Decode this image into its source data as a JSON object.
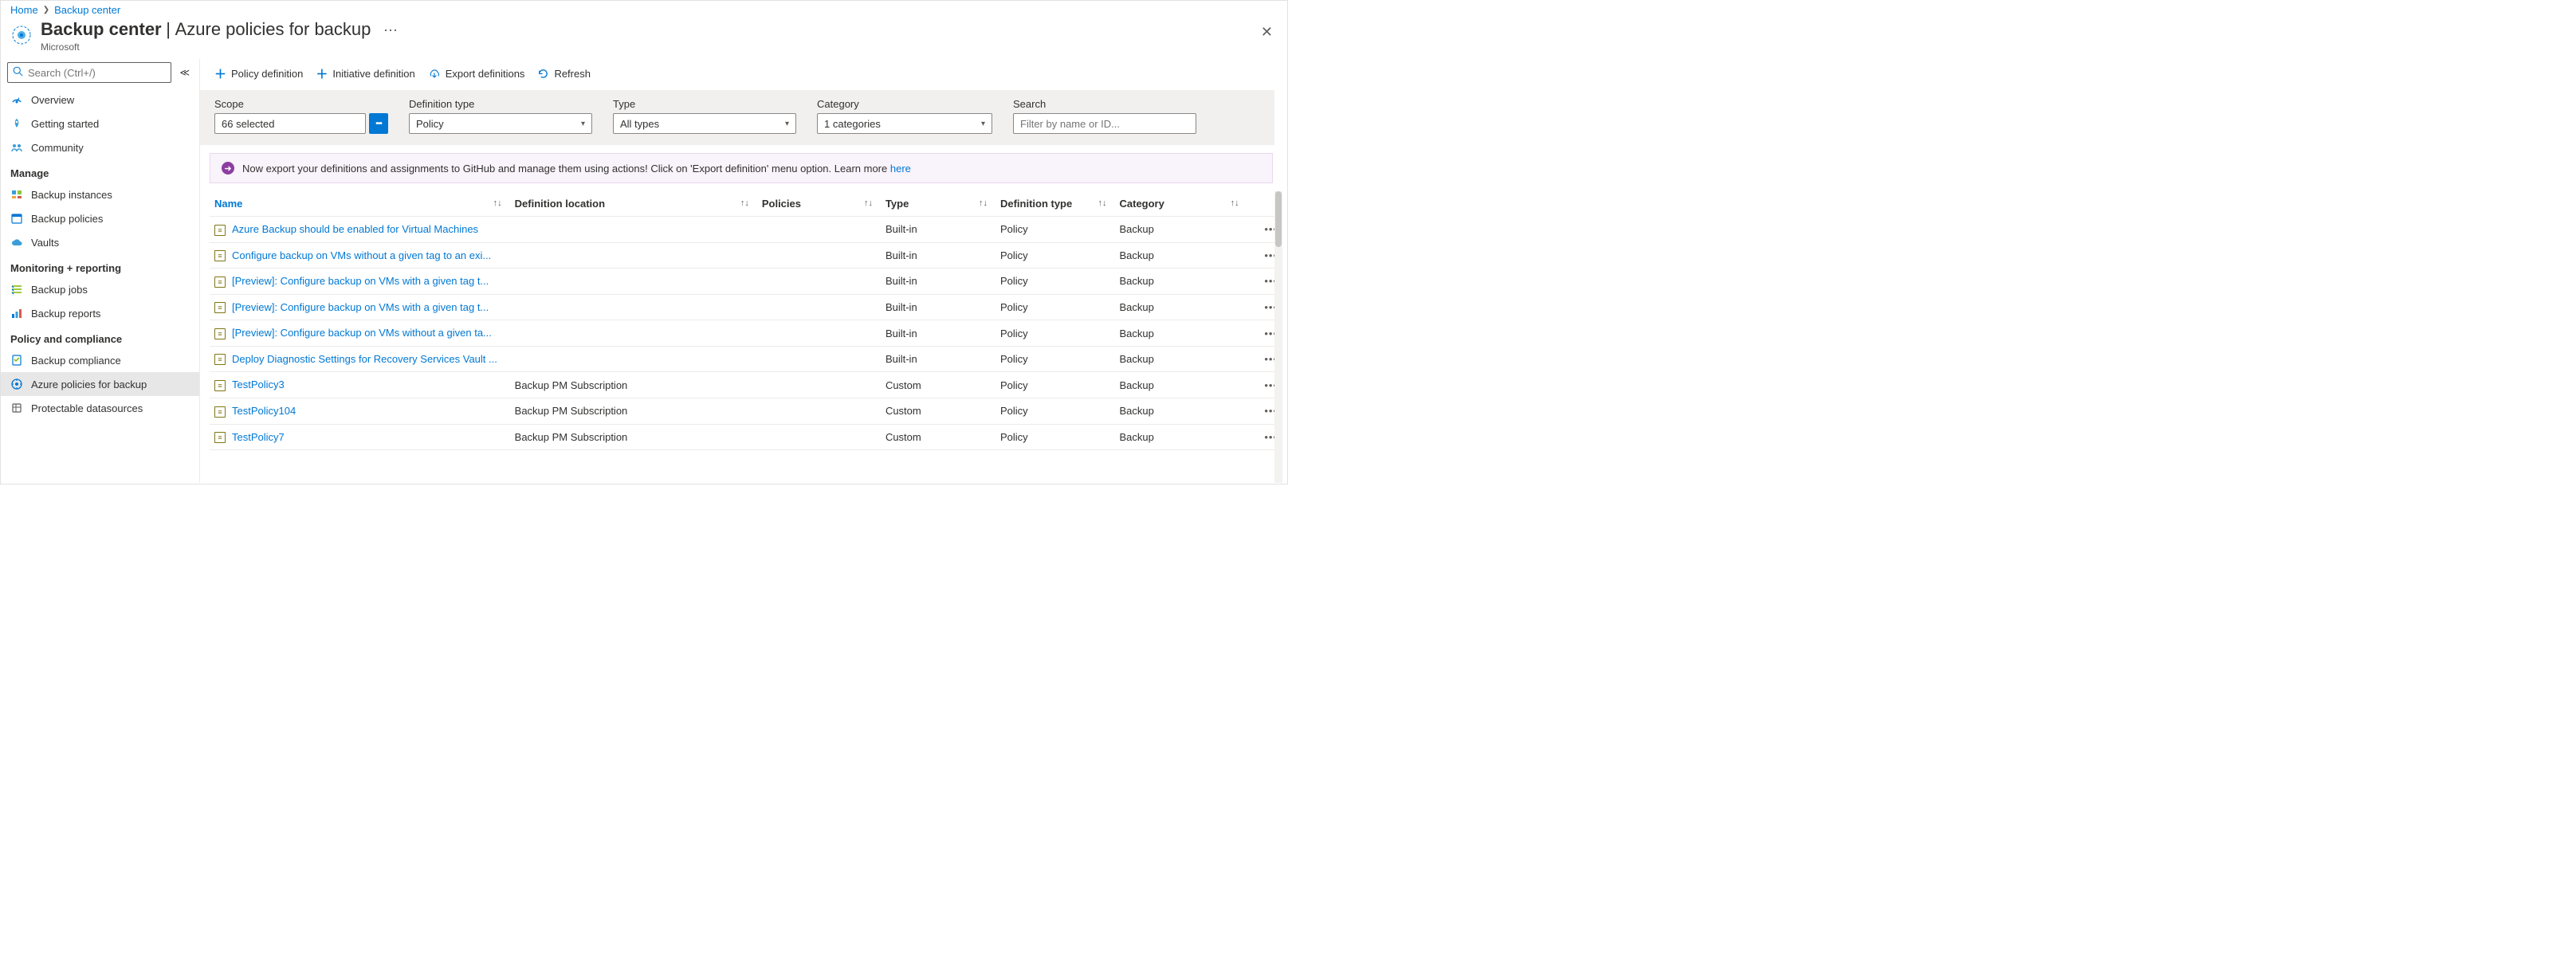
{
  "breadcrumb": {
    "home": "Home",
    "current": "Backup center"
  },
  "header": {
    "title": "Backup center",
    "subtitle": "Azure policies for backup",
    "org": "Microsoft"
  },
  "sidebar": {
    "searchPlaceholder": "Search (Ctrl+/)",
    "top": [
      {
        "label": "Overview",
        "icon": "overview"
      },
      {
        "label": "Getting started",
        "icon": "rocket"
      },
      {
        "label": "Community",
        "icon": "people"
      }
    ],
    "sections": [
      {
        "title": "Manage",
        "items": [
          {
            "label": "Backup instances",
            "icon": "instances"
          },
          {
            "label": "Backup policies",
            "icon": "calendar"
          },
          {
            "label": "Vaults",
            "icon": "cloud"
          }
        ]
      },
      {
        "title": "Monitoring + reporting",
        "items": [
          {
            "label": "Backup jobs",
            "icon": "jobs"
          },
          {
            "label": "Backup reports",
            "icon": "reports"
          }
        ]
      },
      {
        "title": "Policy and compliance",
        "items": [
          {
            "label": "Backup compliance",
            "icon": "compliance"
          },
          {
            "label": "Azure policies for backup",
            "icon": "policy",
            "selected": true
          },
          {
            "label": "Protectable datasources",
            "icon": "datasource"
          }
        ]
      }
    ]
  },
  "toolbar": {
    "policyDef": "Policy definition",
    "initiativeDef": "Initiative definition",
    "exportDef": "Export definitions",
    "refresh": "Refresh"
  },
  "filters": {
    "scope": {
      "label": "Scope",
      "value": "66 selected"
    },
    "defType": {
      "label": "Definition type",
      "value": "Policy"
    },
    "type": {
      "label": "Type",
      "value": "All types"
    },
    "category": {
      "label": "Category",
      "value": "1 categories"
    },
    "search": {
      "label": "Search",
      "placeholder": "Filter by name or ID..."
    }
  },
  "banner": {
    "text": "Now export your definitions and assignments to GitHub and manage them using actions! Click on 'Export definition' menu option. Learn more ",
    "link": "here"
  },
  "columns": {
    "name": "Name",
    "location": "Definition location",
    "policies": "Policies",
    "type": "Type",
    "defType": "Definition type",
    "category": "Category"
  },
  "rows": [
    {
      "name": "Azure Backup should be enabled for Virtual Machines",
      "location": "",
      "type": "Built-in",
      "defType": "Policy",
      "category": "Backup"
    },
    {
      "name": "Configure backup on VMs without a given tag to an exi...",
      "location": "",
      "type": "Built-in",
      "defType": "Policy",
      "category": "Backup"
    },
    {
      "name": "[Preview]: Configure backup on VMs with a given tag t...",
      "location": "",
      "type": "Built-in",
      "defType": "Policy",
      "category": "Backup"
    },
    {
      "name": "[Preview]: Configure backup on VMs with a given tag t...",
      "location": "",
      "type": "Built-in",
      "defType": "Policy",
      "category": "Backup"
    },
    {
      "name": "[Preview]: Configure backup on VMs without a given ta...",
      "location": "",
      "type": "Built-in",
      "defType": "Policy",
      "category": "Backup"
    },
    {
      "name": "Deploy Diagnostic Settings for Recovery Services Vault ...",
      "location": "",
      "type": "Built-in",
      "defType": "Policy",
      "category": "Backup"
    },
    {
      "name": "TestPolicy3",
      "location": "Backup PM Subscription",
      "type": "Custom",
      "defType": "Policy",
      "category": "Backup"
    },
    {
      "name": "TestPolicy104",
      "location": "Backup PM Subscription",
      "type": "Custom",
      "defType": "Policy",
      "category": "Backup"
    },
    {
      "name": "TestPolicy7",
      "location": "Backup PM Subscription",
      "type": "Custom",
      "defType": "Policy",
      "category": "Backup"
    }
  ]
}
